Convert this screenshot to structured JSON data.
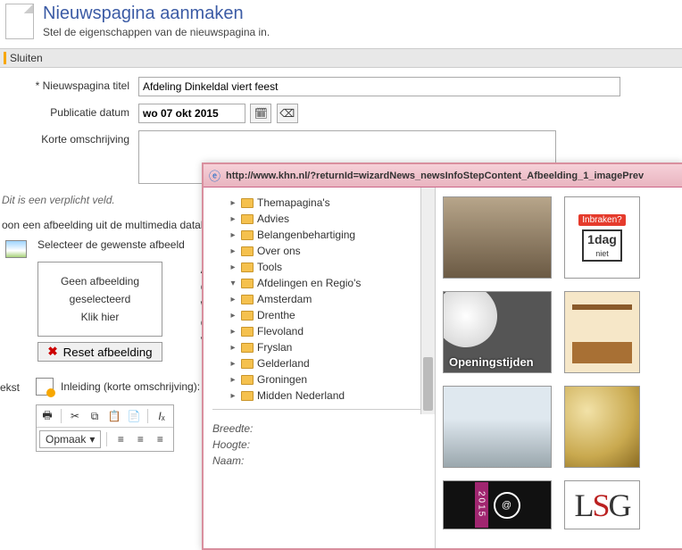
{
  "header": {
    "title": "Nieuwspagina aanmaken",
    "subtitle": "Stel de eigenschappen van de nieuwspagina in."
  },
  "toolbar": {
    "close": "Sluiten"
  },
  "form": {
    "title_label": "Nieuwspagina titel",
    "title_value": "Afdeling Dinkeldal viert feest",
    "pubdate_label": "Publicatie datum",
    "pubdate_value": "wo 07 okt 2015",
    "shortdesc_label": "Korte omschrijving",
    "shortdesc_value": "",
    "required_hint": "Dit is een verplicht veld.",
    "choose_img_text": "oon een afbeelding uit de multimedia datab",
    "select_desired": "Selecteer de gewenste afbeeld",
    "no_image_line1": "Geen afbeelding",
    "no_image_line2": "geselecteerd",
    "no_image_line3": "Klik hier",
    "reset_img": "Reset afbeelding",
    "meta_letters": [
      "A",
      "O",
      "W",
      "O",
      "V"
    ]
  },
  "tekst": {
    "label": "ekst",
    "inleiding": "Inleiding (korte omschrijving):",
    "opmaak": "Opmaak"
  },
  "popup": {
    "url": "http://www.khn.nl/?returnId=wizardNews_newsInfoStepContent_Afbeelding_1_imagePrev",
    "tree_top": [
      "Themapagina's",
      "Advies",
      "Belangenbehartiging",
      "Over ons",
      "Tools"
    ],
    "tree_expanded_label": "Afdelingen en Regio's",
    "tree_sub": [
      "Amsterdam",
      "Drenthe",
      "Flevoland",
      "Fryslan",
      "Gelderland",
      "Groningen",
      "Midden Nederland"
    ],
    "meta": {
      "breedte": "Breedte:",
      "hoogte": "Hoogte:",
      "naam": "Naam:"
    },
    "thumbs": {
      "inbraken_top": "Inbraken?",
      "inbraken_big": "1dag",
      "inbraken_small": "niet",
      "open_txt": "Openingstijden",
      "black_year": "2015",
      "black_at": "@",
      "lsg": "LSG"
    }
  }
}
